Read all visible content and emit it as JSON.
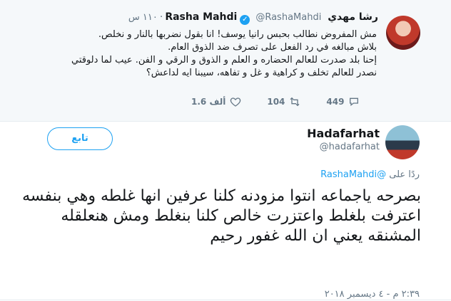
{
  "quoted_tweet": {
    "author_name": "رشا مهدي Rasha Mahdi",
    "verified_label": "✓",
    "handle": "@RashaMahdi",
    "separator": "·",
    "time": "١١٠ س",
    "lines": [
      "مش المفروض نطالب بحبس رانيا يوسف! انا بقول نضربها بالنار و نخلص.",
      "بلاش مبالغه في رد الفعل على تصرف ضد الذوق العام.",
      "إحنا بلد صدرت للعالم الحضاره و العلم و الذوق و الرقي و الفن. عيب لما دلوقتي نصدر للعالم تخلف و كراهية و غل و تفاهه، سيبنا ايه لداعش؟"
    ],
    "actions": {
      "reply_count": "449",
      "retweet_count": "104",
      "like_count": "1.6 ألف"
    }
  },
  "reply_tweet": {
    "author_name": "Hadafarhat",
    "handle": "@hadafarhat",
    "follow_label": "تابع",
    "replying_prefix": "ردًا على",
    "replying_to": "@RashaMahdi",
    "text": "بصرحه ياجماعه انتوا مزودنه كلنا عرفين انها غلطه وهي بنفسه اعترفت بلغلط واعتزرت خالص كلنا بنغلط ومش هنعلقله المشنقه يعني ان الله غفور رحيم",
    "timestamp": "٢:٣٩ م - ٤ ديسمبر ٢٠١٨"
  },
  "icons": {
    "reply": "reply-icon",
    "retweet": "retweet-icon",
    "like": "heart-icon"
  },
  "colors": {
    "accent": "#1da1f2",
    "muted": "#657786",
    "quote_bg": "#f5f8fa"
  }
}
